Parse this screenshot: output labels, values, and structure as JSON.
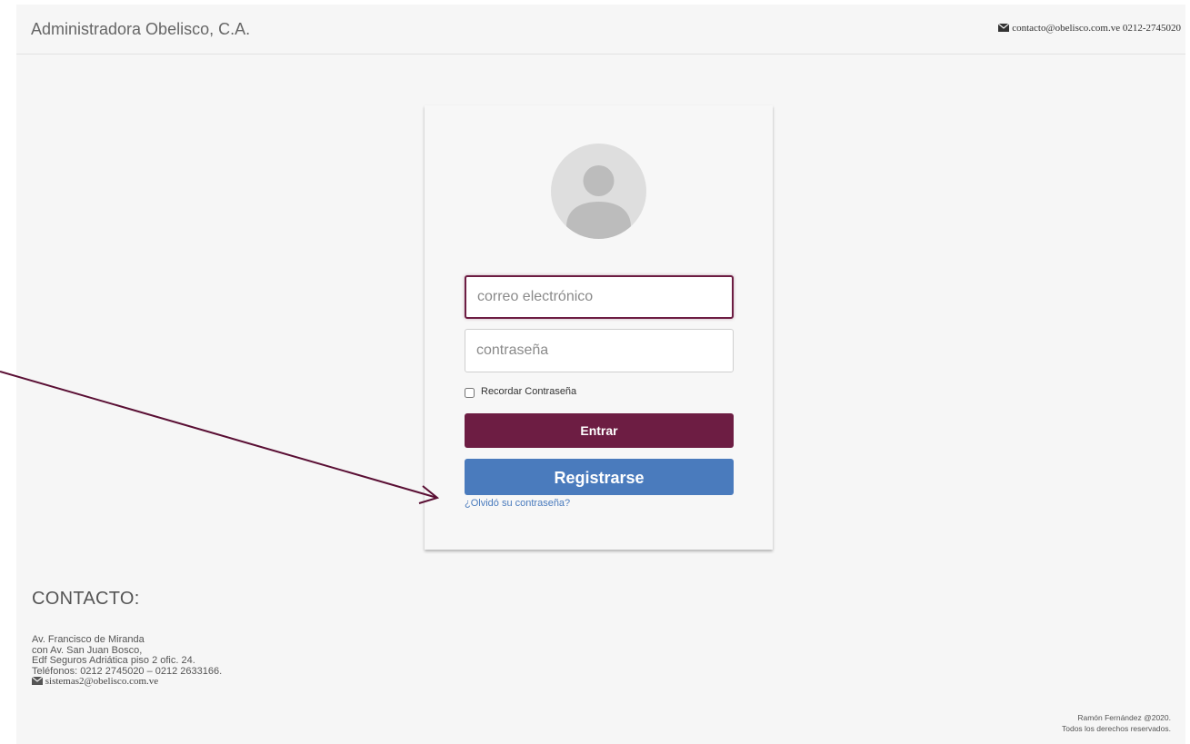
{
  "header": {
    "brand": "Administradora Obelisco, C.A.",
    "contact_email": "contacto@obelisco.com.ve",
    "contact_phone": "0212-2745020",
    "contact_icon": "envelope-icon"
  },
  "login": {
    "avatar_icon": "user-avatar-icon",
    "email_placeholder": "correo electrónico",
    "email_value": "",
    "password_placeholder": "contraseña",
    "password_value": "",
    "remember_label": "Recordar Contraseña",
    "remember_checked": false,
    "enter_label": "Entrar",
    "register_label": "Registrarse",
    "forgot_label": "¿Olvidó su contraseña?"
  },
  "contact": {
    "title": "CONTACTO:",
    "address_lines": [
      "Av. Francisco de Miranda",
      "con Av. San Juan Bosco,",
      "Edf Seguros Adriática piso 2 ofic. 24.",
      "Teléfonos: 0212 2745020 – 0212 2633166."
    ],
    "email": "sistemas2@obelisco.com.ve",
    "email_icon": "envelope-icon"
  },
  "footer": {
    "author": "Ramón Fernández @2020.",
    "rights": "Todos los derechos reservados."
  },
  "colors": {
    "page_background": "#f6f6f6",
    "brand_maroon": "#6d1d43",
    "register_blue": "#4a7bbd",
    "annotation_arrow": "#5a0f34"
  }
}
